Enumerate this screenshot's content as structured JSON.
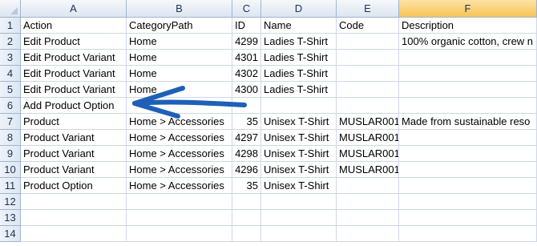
{
  "spreadsheet": {
    "columns": [
      "A",
      "B",
      "C",
      "D",
      "E",
      "F"
    ],
    "rows": [
      {
        "num": "1",
        "cells": [
          "Action",
          "CategoryPath",
          "ID",
          "Name",
          "Code",
          "Description"
        ]
      },
      {
        "num": "2",
        "cells": [
          "Edit Product",
          "Home",
          "4299",
          "Ladies T-Shirt",
          "",
          "100% organic cotton, crew n"
        ]
      },
      {
        "num": "3",
        "cells": [
          "Edit Product Variant",
          "Home",
          "4301",
          "Ladies T-Shirt",
          "",
          ""
        ]
      },
      {
        "num": "4",
        "cells": [
          "Edit Product Variant",
          "Home",
          "4302",
          "Ladies T-Shirt",
          "",
          ""
        ]
      },
      {
        "num": "5",
        "cells": [
          "Edit Product Variant",
          "Home",
          "4300",
          "Ladies T-Shirt",
          "",
          ""
        ]
      },
      {
        "num": "6",
        "cells": [
          "Add Product Option",
          "",
          "",
          "",
          "",
          ""
        ]
      },
      {
        "num": "7",
        "cells": [
          "Product",
          "Home > Accessories",
          "35",
          "Unisex T-Shirt",
          "MUSLAR001",
          "Made from sustainable reso"
        ]
      },
      {
        "num": "8",
        "cells": [
          "Product Variant",
          "Home > Accessories",
          "4297",
          "Unisex T-Shirt",
          "MUSLAR001",
          ""
        ]
      },
      {
        "num": "9",
        "cells": [
          "Product Variant",
          "Home > Accessories",
          "4298",
          "Unisex T-Shirt",
          "MUSLAR001",
          ""
        ]
      },
      {
        "num": "10",
        "cells": [
          "Product Variant",
          "Home > Accessories",
          "4296",
          "Unisex T-Shirt",
          "MUSLAR001",
          ""
        ]
      },
      {
        "num": "11",
        "cells": [
          "Product Option",
          "Home > Accessories",
          "35",
          "Unisex T-Shirt",
          "",
          ""
        ]
      },
      {
        "num": "12",
        "cells": [
          "",
          "",
          "",
          "",
          "",
          ""
        ]
      },
      {
        "num": "13",
        "cells": [
          "",
          "",
          "",
          "",
          "",
          ""
        ]
      },
      {
        "num": "14",
        "cells": [
          "",
          "",
          "",
          "",
          "",
          ""
        ]
      }
    ],
    "selected_column": "F"
  },
  "colors": {
    "gridline": "#d0d7e5",
    "header_border": "#9eb6ce",
    "selected_header": "#f8c455",
    "arrow": "#1f5fb8"
  },
  "annotation": {
    "icon": "arrow-left-icon",
    "points_to_row": "6"
  }
}
